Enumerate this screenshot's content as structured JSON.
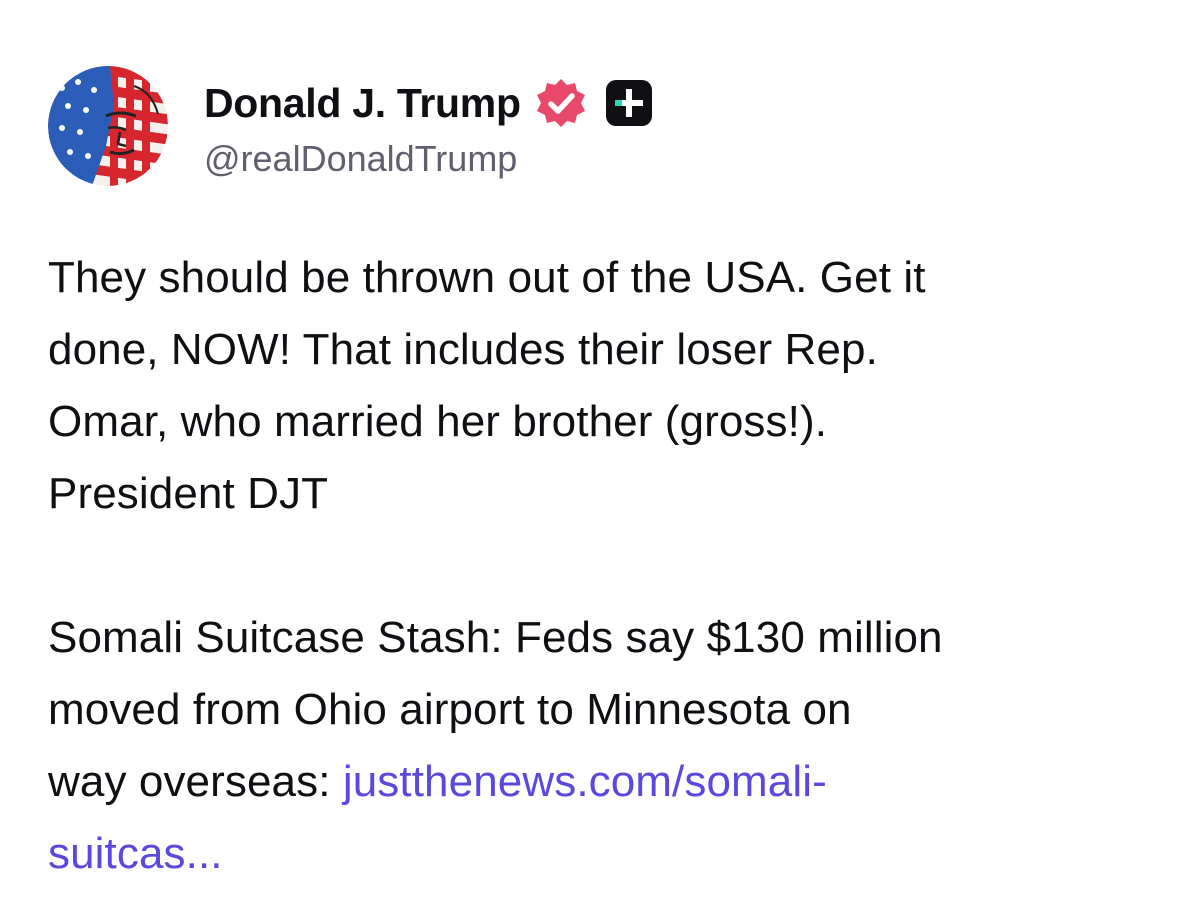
{
  "author": {
    "display_name": "Donald J. Trump",
    "handle": "@realDonaldTrump",
    "verified_icon": "verified-check-icon",
    "plus_icon": "plus-badge-icon",
    "avatar": "flag-portrait-avatar"
  },
  "post": {
    "line1": "They should be thrown out of the USA. Get it",
    "line2": "done, NOW! That includes their loser Rep.",
    "line3": "Omar, who married her brother (gross!).",
    "line4": "President DJT",
    "line5": "Somali Suitcase Stash: Feds say $130 million",
    "line6": "moved from Ohio airport to Minnesota on",
    "line7_text": "way overseas: ",
    "line7_link": "justthenews.com/somali-",
    "line8_link": "suitcas..."
  },
  "colors": {
    "link": "#5a48df",
    "verified": "#e8496a",
    "plus_badge_bg": "#0f0f14",
    "plus_badge_accent": "#29d6b6",
    "handle": "#5f5f6e"
  }
}
